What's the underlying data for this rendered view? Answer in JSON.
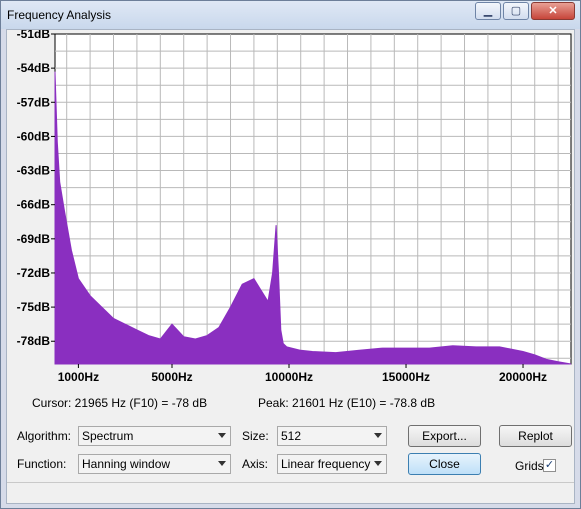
{
  "window": {
    "title": "Frequency Analysis"
  },
  "titlebar_buttons": [
    "minimize-icon",
    "maximize-icon",
    "close-icon"
  ],
  "chart_data": {
    "type": "area",
    "xlabel": "",
    "ylabel": "",
    "xlim": [
      0,
      22050
    ],
    "ylim": [
      -80,
      -51
    ],
    "grid": true,
    "color": "#8a2fc0",
    "y_ticks": [
      "-51dB",
      "-54dB",
      "-57dB",
      "-60dB",
      "-63dB",
      "-66dB",
      "-69dB",
      "-72dB",
      "-75dB",
      "-78dB"
    ],
    "y_tick_values": [
      -51,
      -54,
      -57,
      -60,
      -63,
      -66,
      -69,
      -72,
      -75,
      -78
    ],
    "x_ticks": [
      "1000Hz",
      "5000Hz",
      "10000Hz",
      "15000Hz",
      "20000Hz"
    ],
    "x_tick_values": [
      1000,
      5000,
      10000,
      15000,
      20000
    ],
    "x": [
      0,
      100,
      200,
      400,
      700,
      1000,
      1500,
      2000,
      2500,
      3000,
      3500,
      4000,
      4500,
      5000,
      5500,
      6000,
      6500,
      7000,
      7500,
      8000,
      8500,
      8800,
      9100,
      9300,
      9450,
      9550,
      9650,
      9750,
      9900,
      10500,
      11000,
      12000,
      13000,
      14000,
      15000,
      16000,
      17000,
      18000,
      19000,
      20000,
      20500,
      21000,
      21500,
      22050
    ],
    "values": [
      -54.3,
      -60.5,
      -64.0,
      -66.5,
      -70.0,
      -72.5,
      -74.0,
      -75.0,
      -76.0,
      -76.5,
      -77.0,
      -77.5,
      -77.8,
      -76.5,
      -77.6,
      -77.8,
      -77.5,
      -76.8,
      -75.0,
      -73.0,
      -72.5,
      -73.5,
      -74.5,
      -72.0,
      -67.8,
      -72.0,
      -77.0,
      -78.2,
      -78.5,
      -78.8,
      -78.9,
      -79.0,
      -78.8,
      -78.6,
      -78.6,
      -78.6,
      -78.4,
      -78.5,
      -78.5,
      -78.9,
      -79.2,
      -79.6,
      -79.8,
      -80.0
    ]
  },
  "cursor_readout": "Cursor: 21965 Hz (F10) = -78 dB",
  "peak_readout": "Peak: 21601 Hz (E10) = -78.8 dB",
  "algorithm": {
    "label": "Algorithm:",
    "value": "Spectrum"
  },
  "size": {
    "label": "Size:",
    "value": "512"
  },
  "function": {
    "label": "Function:",
    "value": "Hanning window"
  },
  "axis": {
    "label": "Axis:",
    "value": "Linear frequency"
  },
  "buttons": {
    "export": "Export...",
    "replot": "Replot",
    "close": "Close"
  },
  "grids": {
    "label": "Grids",
    "checked": true,
    "check_mark": "✓"
  }
}
